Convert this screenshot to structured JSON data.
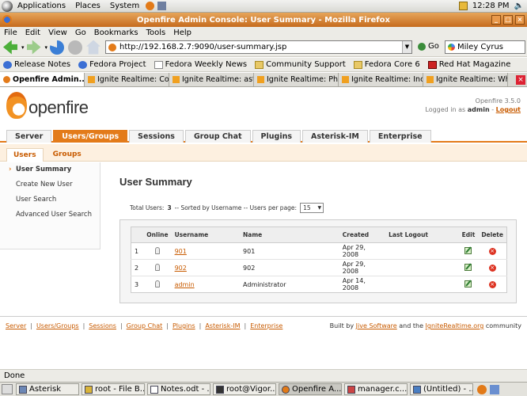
{
  "gnome_panel": {
    "menus": [
      "Applications",
      "Places",
      "System"
    ],
    "clock": "12:28 PM"
  },
  "window": {
    "title": "Openfire Admin Console: User Summary - Mozilla Firefox"
  },
  "menubar": [
    "File",
    "Edit",
    "View",
    "Go",
    "Bookmarks",
    "Tools",
    "Help"
  ],
  "nav": {
    "url": "http://192.168.2.7:9090/user-summary.jsp",
    "go_label": "Go",
    "search_value": "Miley Cyrus"
  },
  "bookmarks": [
    "Release Notes",
    "Fedora Project",
    "Fedora Weekly News",
    "Community Support",
    "Fedora Core 6",
    "Red Hat Magazine"
  ],
  "tabs": [
    "Openfire Admin...",
    "Ignite Realtime: Co...",
    "Ignite Realtime: ast...",
    "Ignite Realtime: Pho...",
    "Ignite Realtime: Inc...",
    "Ignite Realtime: Wh..."
  ],
  "header": {
    "logo_text": "openfire",
    "version": "Openfire 3.5.0",
    "logged_in_prefix": "Logged in as",
    "user": "admin",
    "logout": "Logout"
  },
  "main_tabs": [
    "Server",
    "Users/Groups",
    "Sessions",
    "Group Chat",
    "Plugins",
    "Asterisk-IM",
    "Enterprise"
  ],
  "sub_tabs": [
    "Users",
    "Groups"
  ],
  "sidebar": [
    "User Summary",
    "Create New User",
    "User Search",
    "Advanced User Search"
  ],
  "page": {
    "title": "User Summary",
    "total_label": "Total Users:",
    "total_value": "3",
    "total_suffix": "-- Sorted by Username -- Users per page:",
    "per_page": "15",
    "columns": [
      "",
      "Online",
      "Username",
      "Name",
      "Created",
      "Last Logout",
      "Edit",
      "Delete"
    ],
    "rows": [
      {
        "num": "1",
        "username": "901",
        "name": "901",
        "created": "Apr 29, 2008",
        "last_logout": ""
      },
      {
        "num": "2",
        "username": "902",
        "name": "902",
        "created": "Apr 29, 2008",
        "last_logout": ""
      },
      {
        "num": "3",
        "username": "admin",
        "name": "Administrator",
        "created": "Apr 14, 2008",
        "last_logout": ""
      }
    ]
  },
  "footer": {
    "links": [
      "Server",
      "Users/Groups",
      "Sessions",
      "Group Chat",
      "Plugins",
      "Asterisk-IM",
      "Enterprise"
    ],
    "built_by": "Built by",
    "jive": "Jive Software",
    "and_the": "and the",
    "ignite": "IgniteRealtime.org",
    "community": "community"
  },
  "status": "Done",
  "taskbar": [
    "Asterisk",
    "root - File B...",
    "Notes.odt - ...",
    "root@Vigor...",
    "Openfire A...",
    "manager.c...",
    "(Untitled) - ..."
  ],
  "colors": {
    "accent": "#e37b1a",
    "link": "#c85b00",
    "titlebar": "#c56b1e"
  }
}
